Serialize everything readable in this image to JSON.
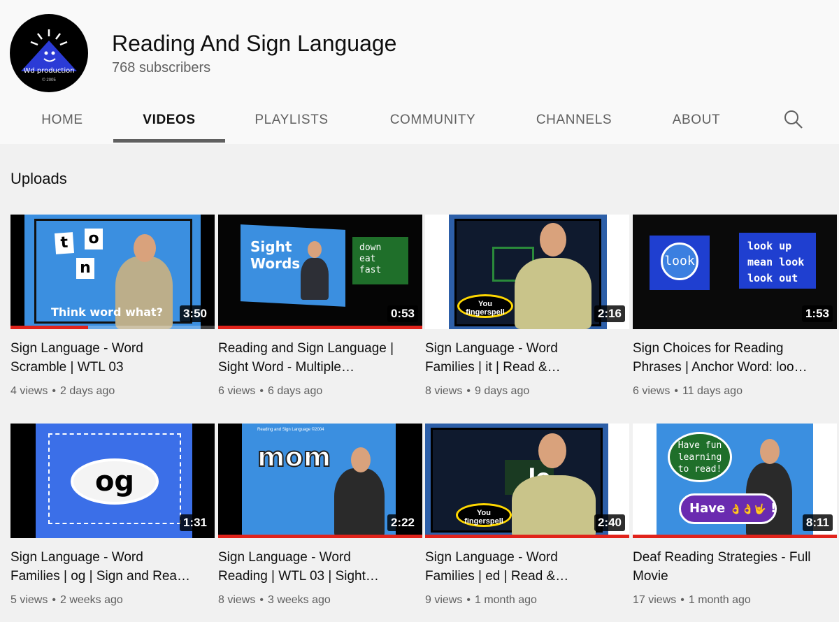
{
  "channel": {
    "name": "Reading And Sign Language",
    "subscribers": "768 subscribers",
    "avatar_text": "Wd production",
    "avatar_year": "© 2005"
  },
  "tabs": [
    {
      "label": "HOME",
      "active": false
    },
    {
      "label": "VIDEOS",
      "active": true
    },
    {
      "label": "PLAYLISTS",
      "active": false
    },
    {
      "label": "COMMUNITY",
      "active": false
    },
    {
      "label": "CHANNELS",
      "active": false
    },
    {
      "label": "ABOUT",
      "active": false
    }
  ],
  "search_icon": "search-icon",
  "section_title": "Uploads",
  "videos": [
    {
      "title_line1": "Sign Language - Word",
      "title_line2": "Scramble | WTL 03",
      "views": "4 views",
      "age": "2 days ago",
      "duration": "3:50",
      "watched_fraction": 0.38,
      "thumb": {
        "tiles": [
          "t",
          "o",
          "n"
        ],
        "caption": "Think word what?"
      }
    },
    {
      "title_line1": "Reading and Sign Language |",
      "title_line2": "Sight Word - Multiple…",
      "views": "6 views",
      "age": "6 days ago",
      "duration": "0:53",
      "watched_fraction": 1.0,
      "thumb": {
        "left_text": "Sight Words",
        "right_words": [
          "down",
          "eat",
          "fast"
        ]
      }
    },
    {
      "title_line1": "Sign Language - Word",
      "title_line2": "Families | it | Read &…",
      "views": "8 views",
      "age": "9 days ago",
      "duration": "2:16",
      "watched_fraction": 0,
      "thumb": {
        "bubble": "You fingerspell"
      }
    },
    {
      "title_line1": "Sign Choices for Reading",
      "title_line2": "Phrases | Anchor Word: loo…",
      "views": "6 views",
      "age": "11 days ago",
      "duration": "1:53",
      "watched_fraction": 0,
      "thumb": {
        "word": "look",
        "phrases": [
          "look up",
          "mean look",
          "look out"
        ]
      }
    },
    {
      "title_line1": "Sign Language - Word",
      "title_line2": "Families | og | Sign and Rea…",
      "views": "5 views",
      "age": "2 weeks ago",
      "duration": "1:31",
      "watched_fraction": 0,
      "thumb": {
        "word": "og"
      }
    },
    {
      "title_line1": "Sign Language - Word",
      "title_line2": "Reading | WTL 03 | Sight…",
      "views": "8 views",
      "age": "3 weeks ago",
      "duration": "2:22",
      "watched_fraction": 1.0,
      "thumb": {
        "word": "mom",
        "top_caption": "Reading and Sign Language ©2004"
      }
    },
    {
      "title_line1": "Sign Language - Word",
      "title_line2": "Families | ed | Read &…",
      "views": "9 views",
      "age": "1 month ago",
      "duration": "2:40",
      "watched_fraction": 1.0,
      "thumb": {
        "bubble": "You fingerspell",
        "fragment": "le"
      }
    },
    {
      "title_line1": "Deaf Reading Strategies - Full",
      "title_line2": "Movie",
      "views": "17 views",
      "age": "1 month ago",
      "duration": "8:11",
      "watched_fraction": 1.0,
      "thumb": {
        "bubble_text": "Have fun learning to read!",
        "pill_text": "Have",
        "pill_signs": "👌👌🤟",
        "pill_end": "!"
      }
    }
  ],
  "colors": {
    "accent_red": "#e1231b",
    "thumb_blue": "#3b8fe0"
  }
}
